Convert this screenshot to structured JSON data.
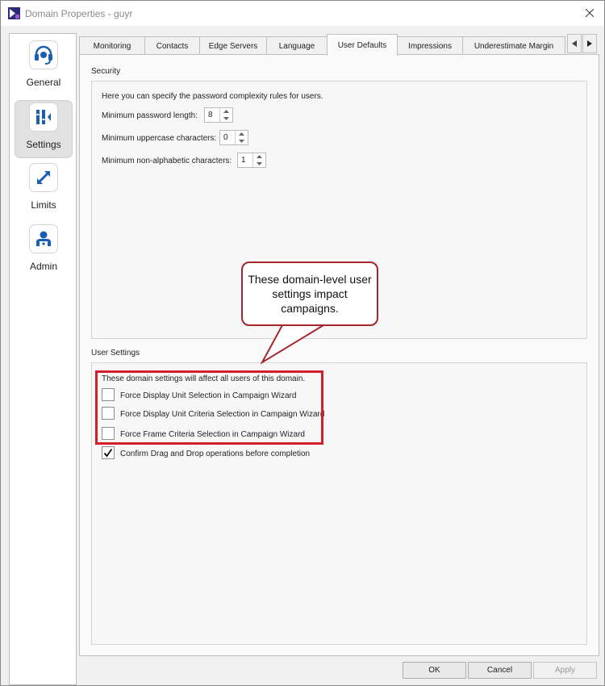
{
  "window": {
    "title": "Domain Properties - guyr"
  },
  "nav": {
    "items": [
      {
        "label": "General",
        "icon": "headset-icon",
        "selected": false
      },
      {
        "label": "Settings",
        "icon": "settings-sliders-icon",
        "selected": true
      },
      {
        "label": "Limits",
        "icon": "resize-arrow-icon",
        "selected": false
      },
      {
        "label": "Admin",
        "icon": "admin-user-icon",
        "selected": false
      }
    ]
  },
  "tabs": [
    {
      "label": "Monitoring",
      "active": false
    },
    {
      "label": "Contacts",
      "active": false
    },
    {
      "label": "Edge Servers",
      "active": false
    },
    {
      "label": "Language",
      "active": false
    },
    {
      "label": "User Defaults",
      "active": true
    },
    {
      "label": "Impressions",
      "active": false
    },
    {
      "label": "Underestimate Margin",
      "active": false
    }
  ],
  "security": {
    "heading": "Security",
    "description": "Here you can specify the password complexity rules for users.",
    "fields": [
      {
        "label": "Minimum password length:",
        "value": "8"
      },
      {
        "label": "Minimum uppercase characters:",
        "value": "0"
      },
      {
        "label": "Minimum non-alphabetic characters:",
        "value": "1"
      }
    ]
  },
  "user_settings": {
    "heading": "User Settings",
    "description": "These domain settings will affect all users of this domain.",
    "options": [
      {
        "label": "Force Display Unit Selection in Campaign Wizard",
        "checked": false
      },
      {
        "label": "Force Display Unit Criteria Selection in Campaign Wizard",
        "checked": false
      },
      {
        "label": "Force Frame Criteria Selection in Campaign Wizard",
        "checked": false
      },
      {
        "label": "Confirm Drag and Drop operations before completion",
        "checked": true
      }
    ]
  },
  "callout": {
    "text": "These domain-level user settings impact campaigns."
  },
  "footer": {
    "ok_label": "OK",
    "cancel_label": "Cancel",
    "apply_label": "Apply"
  },
  "colors": {
    "accent_blue": "#1a5fb4",
    "highlight_red": "#d21f2a",
    "callout_border": "#a4272d"
  }
}
